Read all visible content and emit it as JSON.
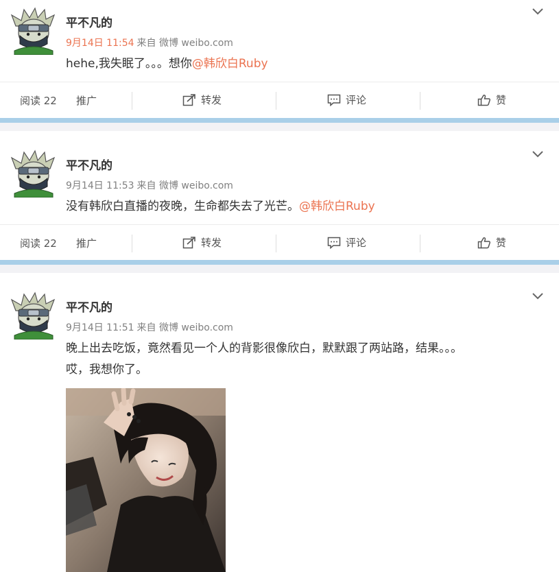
{
  "posts": [
    {
      "username": "平不凡的",
      "time": "9月14日 11:54",
      "source": "来自 微博 weibo.com",
      "text": "hehe,我失眠了。。。想你",
      "mention": "@韩欣白Ruby",
      "actions": {
        "read": "阅读 22",
        "promote": "推广",
        "repost": "转发",
        "comment": "评论",
        "like": "赞"
      }
    },
    {
      "username": "平不凡的",
      "time": "9月14日 11:53",
      "source": "来自 微博 weibo.com",
      "text": "没有韩欣白直播的夜晚，生命都失去了光芒。",
      "mention": "@韩欣白Ruby",
      "actions": {
        "read": "阅读 22",
        "promote": "推广",
        "repost": "转发",
        "comment": "评论",
        "like": "赞"
      }
    },
    {
      "username": "平不凡的",
      "time": "9月14日 11:51",
      "source": "来自 微博 weibo.com",
      "text_line1": "晚上出去吃饭，竟然看见一个人的背影很像欣白，默默跟了两站路，结果。。。",
      "text_line2": "哎，我想你了。"
    }
  ],
  "icons": {
    "caret": "chevron-down-icon",
    "repost": "repost-icon",
    "comment": "comment-icon",
    "like": "thumbs-up-icon"
  },
  "colors": {
    "mention": "#eb7350",
    "highlight_time": "#eb7350",
    "separator": "#a9cfe8"
  }
}
